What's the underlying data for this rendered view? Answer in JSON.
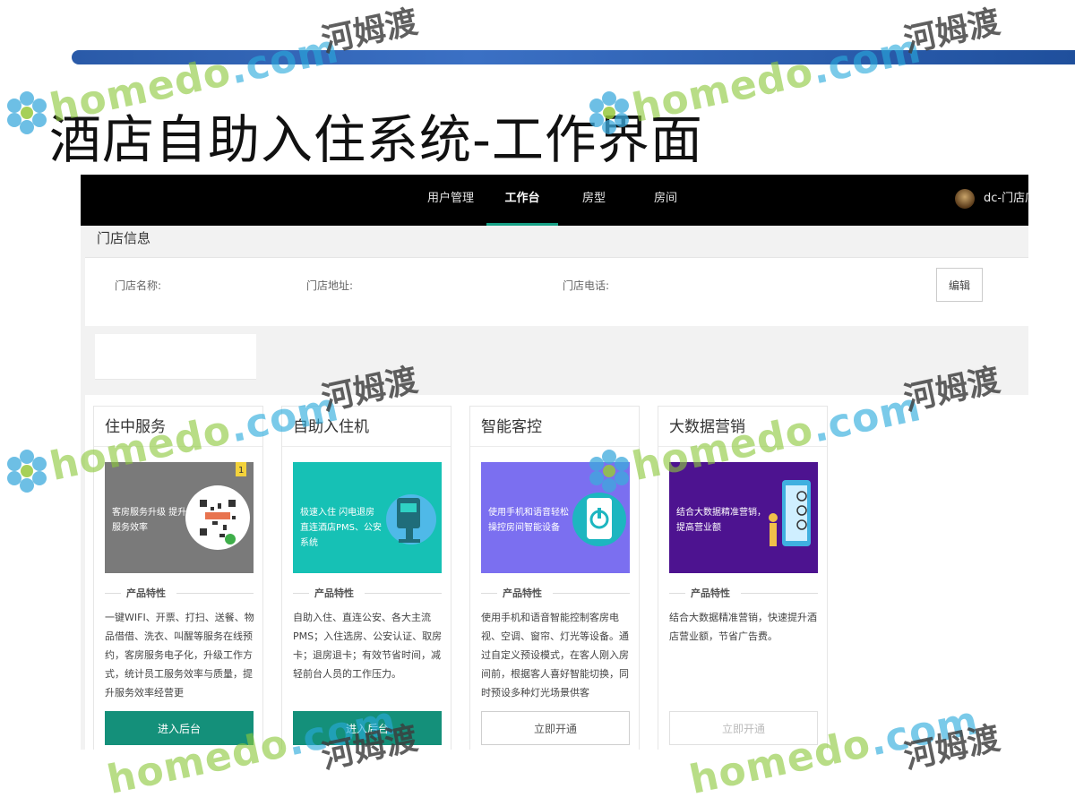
{
  "slide": {
    "title": "酒店自助入住系统-工作界面"
  },
  "app": {
    "nav": {
      "items": [
        {
          "label": "用户管理",
          "active": false
        },
        {
          "label": "工作台",
          "active": true
        },
        {
          "label": "房型",
          "active": false
        },
        {
          "label": "房间",
          "active": false
        }
      ],
      "user_name": "dc-门店店"
    },
    "store": {
      "heading": "门店信息",
      "name_label": "门店名称:",
      "address_label": "门店地址:",
      "phone_label": "门店电话:",
      "edit_label": "编辑"
    },
    "cards": [
      {
        "title": "住中服务",
        "banner_text": "客房服务升级 提升服务效率",
        "banner_color": "#7a7a7a",
        "badge": "1",
        "feature_heading": "产品特性",
        "description": "一键WIFI、开票、打扫、送餐、物品借借、洗衣、叫醒等服务在线预约，客房服务电子化，升级工作方式，统计员工服务效率与质量，提升服务效率经营更",
        "button_label": "进入后台",
        "button_style": "primary"
      },
      {
        "title": "自助入住机",
        "banner_text": "极速入住 闪电退房 直连酒店PMS、公安系统",
        "banner_color": "#16c1b5",
        "feature_heading": "产品特性",
        "description": "自助入住、直连公安、各大主流PMS；入住选房、公安认证、取房卡；退房退卡；有效节省时间，减轻前台人员的工作压力。",
        "button_label": "进入后台",
        "button_style": "primary"
      },
      {
        "title": "智能客控",
        "banner_text": "使用手机和语音轻松操控房间智能设备",
        "banner_color": "#7b6ff0",
        "feature_heading": "产品特性",
        "description": "使用手机和语音智能控制客房电视、空调、窗帘、灯光等设备。通过自定义预设模式，在客人刚入房间前，根据客人喜好智能切换，同时预设多种灯光场景供客",
        "button_label": "立即开通",
        "button_style": "outline"
      },
      {
        "title": "大数据营销",
        "banner_text": "结合大数据精准营销，提高营业额",
        "banner_color": "#4d1390",
        "feature_heading": "产品特性",
        "description": "结合大数据精准营销，快速提升酒店营业额，节省广告费。",
        "button_label": "立即开通",
        "button_style": "disabled"
      }
    ]
  },
  "watermark": {
    "brand": "homedo",
    "domain": ".com",
    "cn": "河姆渡"
  }
}
